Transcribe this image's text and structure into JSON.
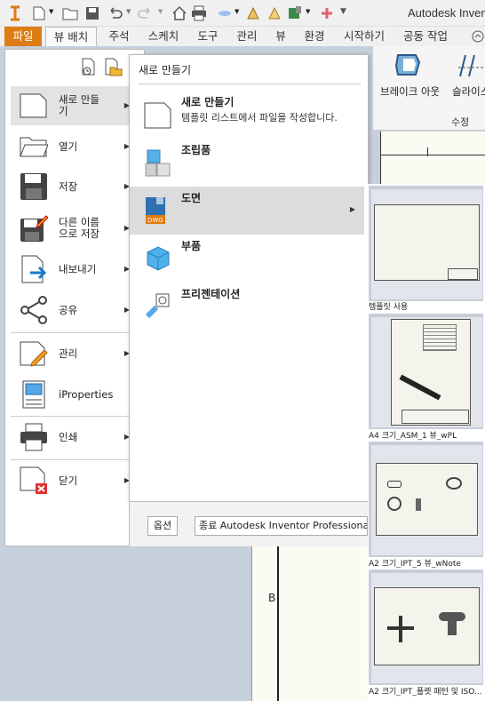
{
  "app": {
    "title": "Autodesk Invent"
  },
  "tabs": [
    "파일",
    "뷰 배치",
    "주석",
    "스케치",
    "도구",
    "관리",
    "뷰",
    "환경",
    "시작하기",
    "공동 작업"
  ],
  "ribbon": {
    "labels": [
      "브레이크 아웃",
      "슬라이스"
    ],
    "group": "수정"
  },
  "left_menu": [
    {
      "label": "새로 만들\n기",
      "icon": "new-document-icon",
      "arrow": true
    },
    {
      "label": "열기",
      "icon": "open-folder-icon",
      "arrow": true
    },
    {
      "label": "저장",
      "icon": "save-disk-icon",
      "arrow": true
    },
    {
      "label": "다른 이름\n으로 저장",
      "icon": "save-as-icon",
      "arrow": true
    },
    {
      "label": "내보내기",
      "icon": "export-icon",
      "arrow": true
    },
    {
      "label": "공유",
      "icon": "share-icon",
      "arrow": true
    },
    {
      "label": "관리",
      "icon": "manage-icon",
      "arrow": true
    },
    {
      "label": "iProperties",
      "icon": "iproperties-icon",
      "arrow": false
    },
    {
      "label": "인쇄",
      "icon": "print-icon",
      "arrow": true
    },
    {
      "label": "닫기",
      "icon": "close-document-icon",
      "arrow": true
    }
  ],
  "submenu": {
    "title": "새로 만들기",
    "items": [
      {
        "label": "새로 만들기",
        "desc": "템플릿 리스트에서 파일을 작성합니다.",
        "icon": "new-document-icon"
      },
      {
        "label": "조립품",
        "desc": "",
        "icon": "assembly-icon"
      },
      {
        "label": "도면",
        "desc": "",
        "icon": "drawing-dwg-icon"
      },
      {
        "label": "부품",
        "desc": "",
        "icon": "part-cube-icon"
      },
      {
        "label": "프리젠테이션",
        "desc": "",
        "icon": "presentation-icon"
      }
    ]
  },
  "bottom": {
    "options": "옵션",
    "close_app": "종료 Autodesk Inventor Professional"
  },
  "templates": [
    "템플릿 사용",
    "A4 크기_ASM_1 뷰_wPL",
    "A2 크기_IPT_5 뷰_wNote",
    "A2 크기_IPT_플렛 패턴 및 ISO..."
  ],
  "sheet": {
    "zone_label": "B"
  }
}
